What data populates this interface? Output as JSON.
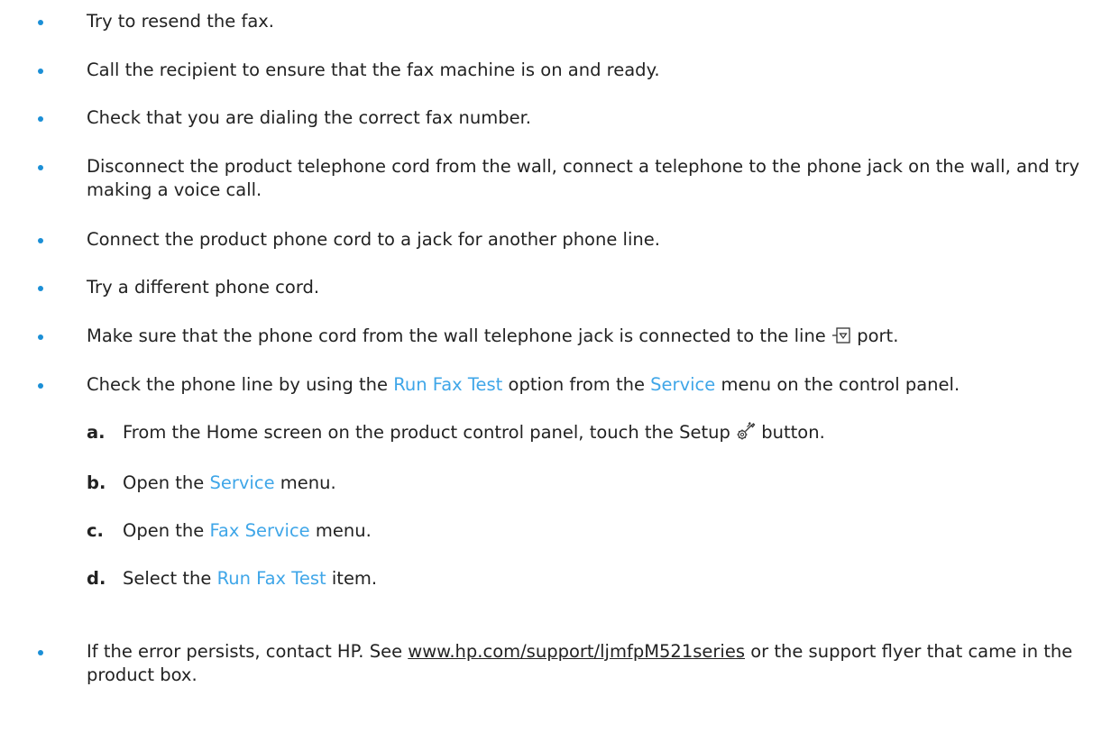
{
  "items": [
    {
      "text": "Try to resend the fax."
    },
    {
      "text": "Call the recipient to ensure that the fax machine is on and ready."
    },
    {
      "text": "Check that you are dialing the correct fax number."
    },
    {
      "text": "Disconnect the product telephone cord from the wall, connect a telephone to the phone jack on the wall, and try making a voice call."
    },
    {
      "text": "Connect the product phone cord to a jack for another phone line."
    },
    {
      "text": "Try a different phone cord."
    },
    {
      "before": "Make sure that the phone cord from the wall telephone jack is connected to the line",
      "icon": "line-port-icon",
      "after": "port."
    },
    {
      "before": "Check the phone line by using the",
      "link1": "Run Fax Test",
      "middle": "option from the",
      "link2": "Service",
      "after": "menu on the control panel."
    },
    {
      "before": "If the error persists, contact HP. See",
      "url": "www.hp.com/support/ljmfpM521series",
      "after": "or the support flyer that came in the product box."
    }
  ],
  "steps": [
    {
      "letter": "a.",
      "before": "From the Home screen on the product control panel, touch the Setup",
      "icon": "setup-wrench-icon",
      "after": "button."
    },
    {
      "letter": "b.",
      "before": "Open the",
      "link": "Service",
      "after": "menu."
    },
    {
      "letter": "c.",
      "before": "Open the",
      "link": "Fax Service",
      "after": "menu."
    },
    {
      "letter": "d.",
      "before": "Select the",
      "link": "Run Fax Test",
      "after": "item."
    }
  ],
  "colors": {
    "bullet": "#1b8fd6",
    "menu_link": "#3fa6e8",
    "body_text": "#222222"
  }
}
